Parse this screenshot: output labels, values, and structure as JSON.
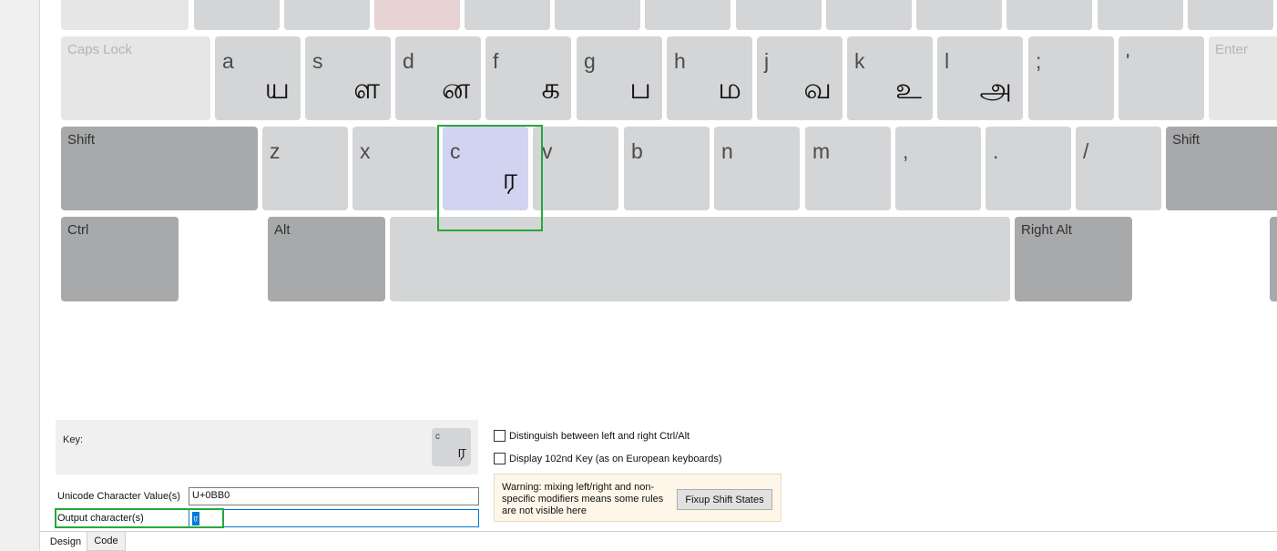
{
  "keyboard": {
    "row_top_labels": [
      "",
      "",
      "",
      "",
      "",
      "",
      "",
      "",
      "",
      "",
      "",
      "",
      "",
      ""
    ],
    "caps_lock": "Caps Lock",
    "enter": "Enter",
    "shift_left": "Shift",
    "shift_right": "Shift",
    "ctrl": "Ctrl",
    "alt": "Alt",
    "right_alt": "Right Alt",
    "home_row": [
      {
        "base": "a",
        "out": "ய"
      },
      {
        "base": "s",
        "out": "ள"
      },
      {
        "base": "d",
        "out": "ன"
      },
      {
        "base": "f",
        "out": "க"
      },
      {
        "base": "g",
        "out": "ப"
      },
      {
        "base": "h",
        "out": "ம"
      },
      {
        "base": "j",
        "out": "வ"
      },
      {
        "base": "k",
        "out": "உ"
      },
      {
        "base": "l",
        "out": "அ"
      },
      {
        "base": ";",
        "out": ""
      },
      {
        "base": "'",
        "out": ""
      }
    ],
    "bottom_row": [
      {
        "base": "z",
        "out": ""
      },
      {
        "base": "x",
        "out": ""
      },
      {
        "base": "c",
        "out": "ர"
      },
      {
        "base": "v",
        "out": ""
      },
      {
        "base": "b",
        "out": ""
      },
      {
        "base": "n",
        "out": ""
      },
      {
        "base": "m",
        "out": ""
      },
      {
        "base": ",",
        "out": ""
      },
      {
        "base": ".",
        "out": ""
      },
      {
        "base": "/",
        "out": ""
      }
    ]
  },
  "key_panel": {
    "key_label": "Key:",
    "mini_key_base": "c",
    "mini_key_out": "ர"
  },
  "fields": {
    "unicode_label": "Unicode Character Value(s)",
    "unicode_value": "U+0BB0",
    "output_label": "Output character(s)",
    "output_value": "ர"
  },
  "options": {
    "distinguish": "Distinguish between left and right Ctrl/Alt",
    "display102": "Display 102nd Key (as on European keyboards)"
  },
  "warning": {
    "text": "Warning: mixing left/right and non-specific modifiers means some rules are not visible here",
    "button": "Fixup Shift States"
  },
  "tabs": {
    "design": "Design",
    "code": "Code"
  },
  "colors": {
    "highlight": "#22a93c",
    "selected_key": "#d2d3f0",
    "key": "#d4d5d7",
    "modifier_key": "#a8a9ab"
  }
}
